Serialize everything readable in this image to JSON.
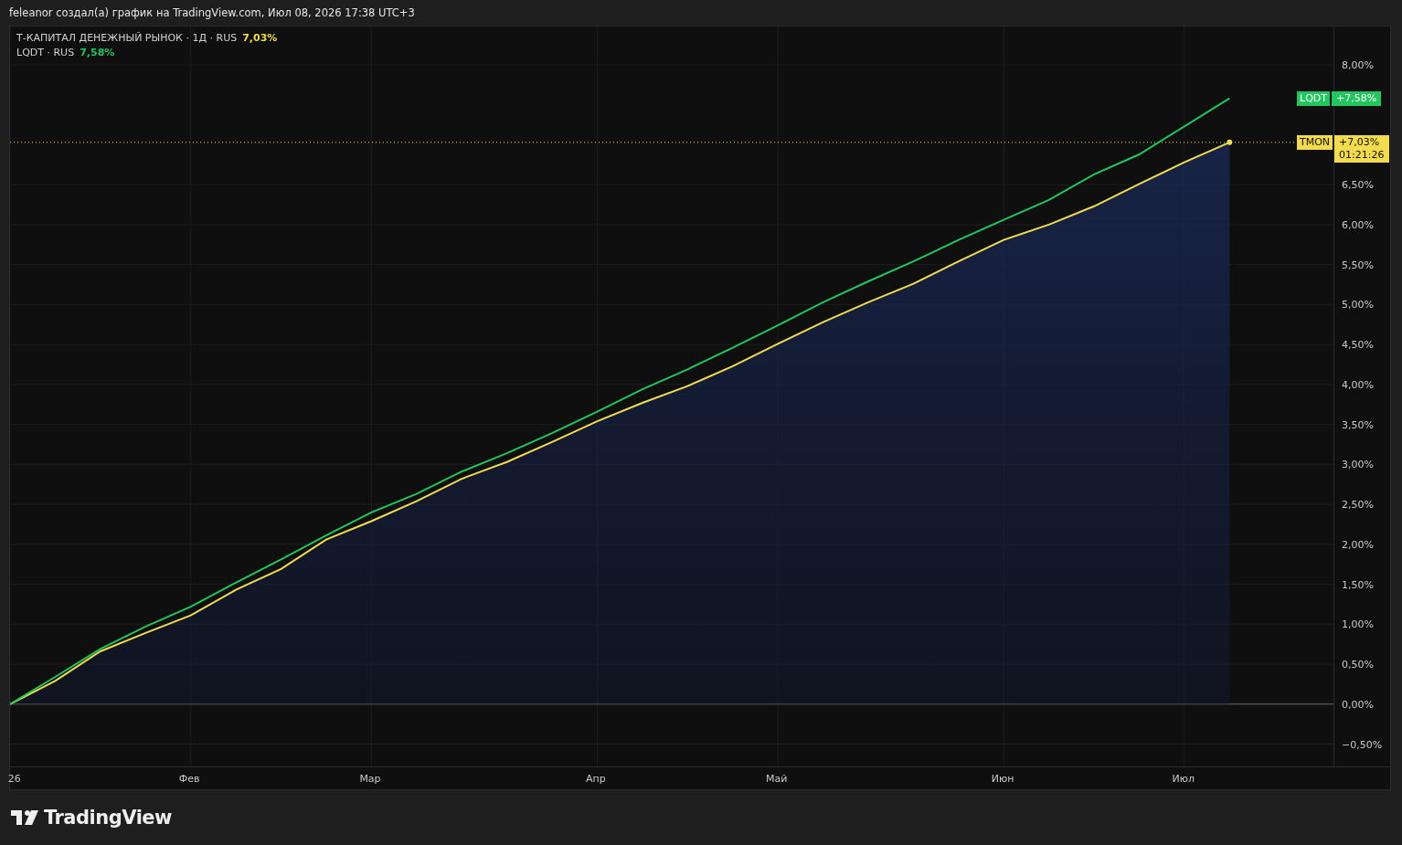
{
  "header": {
    "text": "feleanor создал(а) график на TradingView.com, Июл 08, 2026 17:38 UTC+3"
  },
  "legend": [
    {
      "label": "Т-КАПИТАЛ ДЕНЕЖНЫЙ РЫНОК · 1Д · RUS",
      "value": "7,03%",
      "color": "#f2dc4e"
    },
    {
      "label": "LQDT · RUS",
      "value": "7,58%",
      "color": "#22c55e"
    }
  ],
  "chart_data": {
    "type": "line",
    "grid": true,
    "ylim": [
      -0.78,
      8.48
    ],
    "categories": [
      "26",
      null,
      null,
      null,
      "Фев",
      null,
      null,
      null,
      "Мар",
      null,
      null,
      null,
      null,
      "Апр",
      null,
      null,
      null,
      "Май",
      null,
      null,
      null,
      null,
      "Июн",
      null,
      null,
      null,
      "Июл",
      null
    ],
    "yticks": [
      {
        "value": -0.5,
        "label": "−0,50%"
      },
      {
        "value": 0,
        "label": "0,00%"
      },
      {
        "value": 0.5,
        "label": "0,50%"
      },
      {
        "value": 1,
        "label": "1,00%"
      },
      {
        "value": 1.5,
        "label": "1,50%"
      },
      {
        "value": 2,
        "label": "2,00%"
      },
      {
        "value": 2.5,
        "label": "2,50%"
      },
      {
        "value": 3,
        "label": "3,00%"
      },
      {
        "value": 3.5,
        "label": "3,50%"
      },
      {
        "value": 4,
        "label": "4,00%"
      },
      {
        "value": 4.5,
        "label": "4,50%"
      },
      {
        "value": 5,
        "label": "5,00%"
      },
      {
        "value": 5.5,
        "label": "5,50%"
      },
      {
        "value": 6,
        "label": "6,00%"
      },
      {
        "value": 6.5,
        "label": "6,50%"
      },
      {
        "value": 8,
        "label": "8,00%"
      }
    ],
    "series": [
      {
        "name": "TMON",
        "type": "area",
        "color": "#f2dc4e",
        "values": [
          0,
          0.29,
          0.66,
          0.89,
          1.11,
          1.43,
          1.69,
          2.06,
          2.29,
          2.54,
          2.82,
          3.03,
          3.28,
          3.54,
          3.77,
          3.98,
          4.23,
          4.51,
          4.78,
          5.03,
          5.26,
          5.54,
          5.81,
          6.0,
          6.23,
          6.51,
          6.78,
          7.03
        ]
      },
      {
        "name": "LQDT",
        "color": "#22c55e",
        "values": [
          0,
          0.34,
          0.69,
          0.97,
          1.22,
          1.52,
          1.81,
          2.11,
          2.4,
          2.63,
          2.91,
          3.14,
          3.39,
          3.66,
          3.94,
          4.19,
          4.46,
          4.74,
          5.03,
          5.29,
          5.54,
          5.81,
          6.06,
          6.31,
          6.63,
          6.88,
          7.23,
          7.58
        ]
      }
    ]
  },
  "price_badges": [
    {
      "value": "+7,58%"
    },
    {
      "value": "+7,03%",
      "timer": "01:21:26"
    }
  ],
  "footer": {
    "logo_text": "TradingView"
  }
}
